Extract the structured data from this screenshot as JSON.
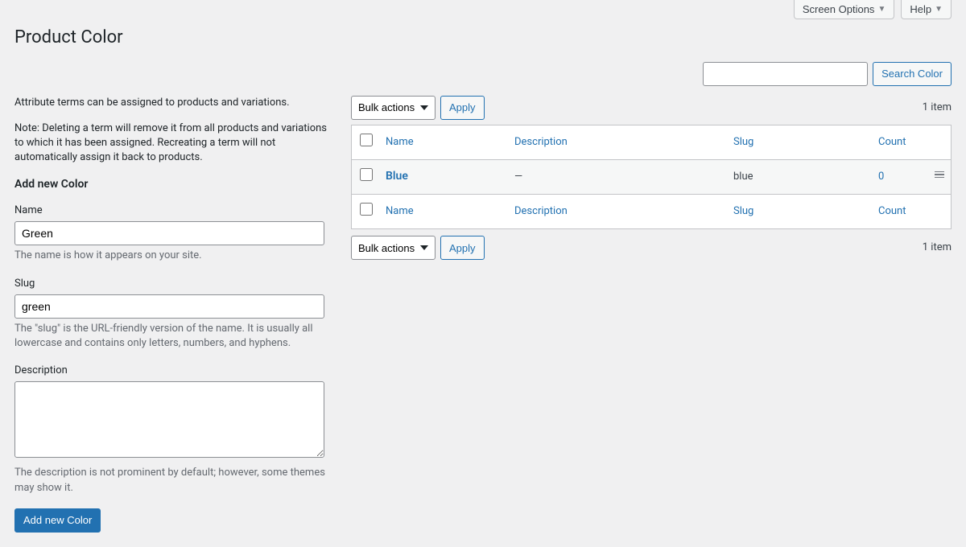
{
  "header": {
    "screen_options_label": "Screen Options",
    "help_label": "Help",
    "triangle": "▼"
  },
  "page_title": "Product Color",
  "search": {
    "button": "Search Color"
  },
  "left": {
    "intro": "Attribute terms can be assigned to products and variations.",
    "note": "Note: Deleting a term will remove it from all products and variations to which it has been assigned. Recreating a term will not automatically assign it back to products.",
    "section_title": "Add new Color",
    "name": {
      "label": "Name",
      "value": "Green",
      "help": "The name is how it appears on your site."
    },
    "slug": {
      "label": "Slug",
      "value": "green",
      "help": "The \"slug\" is the URL-friendly version of the name. It is usually all lowercase and contains only letters, numbers, and hyphens."
    },
    "description": {
      "label": "Description",
      "value": "",
      "help": "The description is not prominent by default; however, some themes may show it."
    },
    "submit": "Add new Color"
  },
  "right": {
    "bulk_label": "Bulk actions",
    "apply_label": "Apply",
    "item_count": "1 item",
    "columns": {
      "name": "Name",
      "description": "Description",
      "slug": "Slug",
      "count": "Count"
    },
    "rows": [
      {
        "name": "Blue",
        "description": "—",
        "slug": "blue",
        "count": "0"
      }
    ]
  }
}
